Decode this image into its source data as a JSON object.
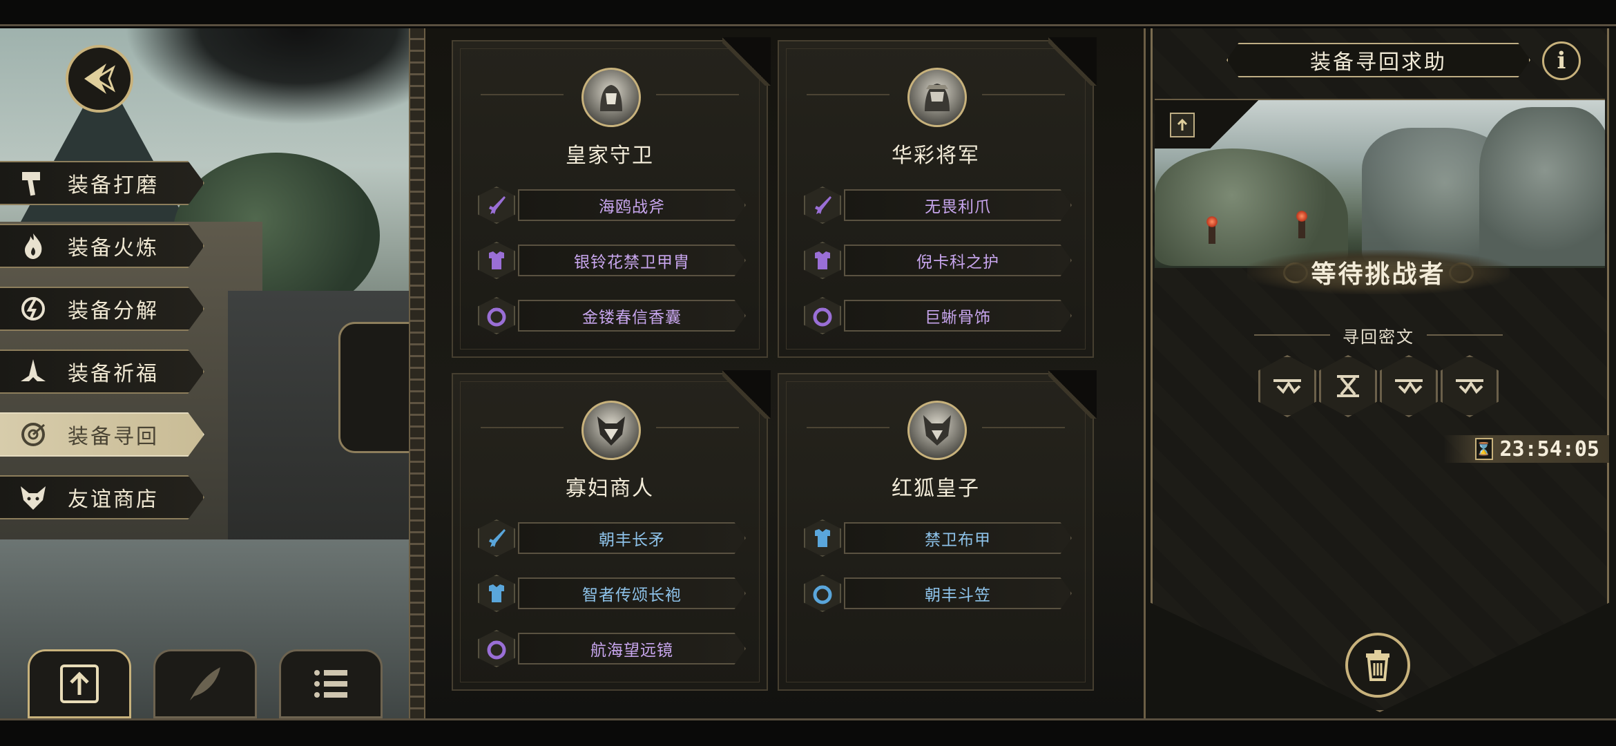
{
  "left_menu": {
    "items": [
      {
        "label": "装备打磨",
        "icon": "hammer-icon"
      },
      {
        "label": "装备火炼",
        "icon": "flame-icon"
      },
      {
        "label": "装备分解",
        "icon": "dismantle-icon"
      },
      {
        "label": "装备祈福",
        "icon": "pray-icon"
      },
      {
        "label": "装备寻回",
        "icon": "target-icon",
        "active": true
      },
      {
        "label": "友谊商店",
        "icon": "fox-icon"
      }
    ]
  },
  "cards": [
    {
      "name": "皇家守卫",
      "items": [
        {
          "name": "海鸥战斧",
          "type": "weapon",
          "rarity": "purple"
        },
        {
          "name": "银铃花禁卫甲胄",
          "type": "armor",
          "rarity": "purple"
        },
        {
          "name": "金镂春信香囊",
          "type": "ring",
          "rarity": "purple"
        }
      ]
    },
    {
      "name": "华彩将军",
      "items": [
        {
          "name": "无畏利爪",
          "type": "weapon",
          "rarity": "purple"
        },
        {
          "name": "倪卡科之护",
          "type": "armor",
          "rarity": "purple"
        },
        {
          "name": "巨蜥骨饰",
          "type": "ring",
          "rarity": "purple"
        }
      ]
    },
    {
      "name": "寡妇商人",
      "items": [
        {
          "name": "朝丰长矛",
          "type": "weapon",
          "rarity": "blue"
        },
        {
          "name": "智者传颂长袍",
          "type": "armor",
          "rarity": "blue"
        },
        {
          "name": "航海望远镜",
          "type": "ring",
          "rarity": "purple"
        }
      ]
    },
    {
      "name": "红狐皇子",
      "items": [
        {
          "name": "禁卫布甲",
          "type": "armor",
          "rarity": "blue"
        },
        {
          "name": "朝丰斗笠",
          "type": "ring",
          "rarity": "blue"
        }
      ]
    }
  ],
  "right_panel": {
    "title": "装备寻回求助",
    "info_label": "i",
    "status": "等待挑战者",
    "cipher_label": "寻回密文",
    "timer": "23:54:05"
  },
  "colors": {
    "gold": "#c8b27c",
    "purple_text": "#c8a6ee",
    "purple_icon": "#9a6fd6",
    "blue_text": "#8ec3ea",
    "blue_icon": "#5aa6db",
    "active_menu": "#d7ccab"
  }
}
